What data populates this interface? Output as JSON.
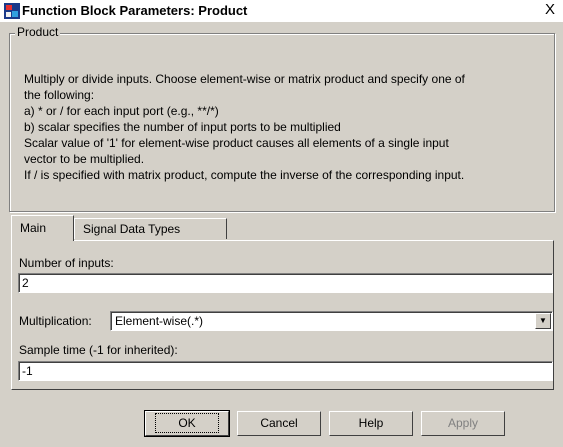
{
  "window": {
    "title": "Function Block Parameters: Product",
    "close_glyph": "X"
  },
  "group": {
    "label": "Product",
    "description": [
      "Multiply or divide inputs.  Choose element-wise or matrix product and specify one of",
      "the following:",
      "a) * or / for each input port (e.g., **/*)",
      "b) scalar specifies the number of input ports to be multiplied",
      "Scalar value of '1' for element-wise product causes all elements of a single input",
      "vector to be multiplied.",
      "If / is specified with matrix product, compute the inverse of the corresponding input."
    ]
  },
  "tabs": [
    {
      "label": "Main",
      "active": true
    },
    {
      "label": "Signal Data Types",
      "active": false
    }
  ],
  "main": {
    "inputs_label": "Number of inputs:",
    "inputs_value": "2",
    "multiplication_label": "Multiplication:",
    "multiplication_value": "Element-wise(.*)",
    "sample_label": "Sample time (-1 for inherited):",
    "sample_value": "-1"
  },
  "buttons": {
    "ok": "OK",
    "cancel": "Cancel",
    "help": "Help",
    "apply": "Apply"
  }
}
